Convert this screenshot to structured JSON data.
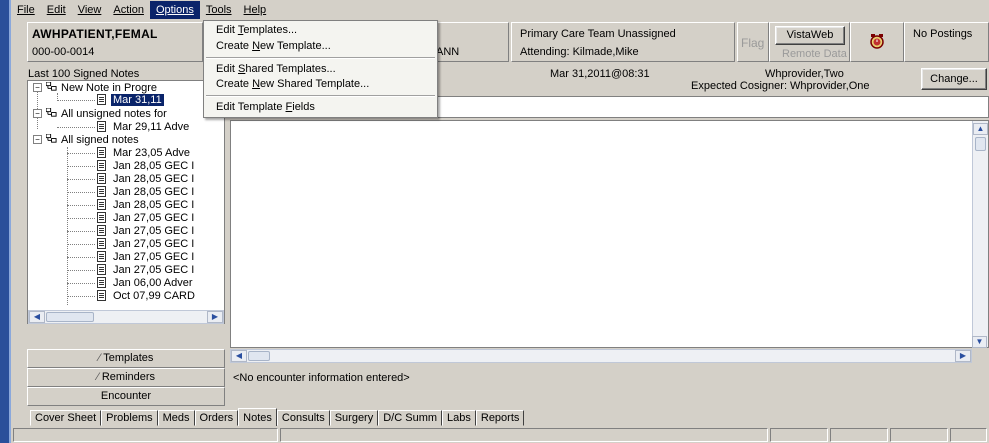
{
  "menubar": {
    "items": [
      "File",
      "Edit",
      "View",
      "Action",
      "Options",
      "Tools",
      "Help"
    ],
    "active_index": 4
  },
  "options_menu": {
    "items": [
      "Edit Templates...",
      "Create New Template...",
      "Edit Shared Templates...",
      "Create New Shared Template...",
      "Edit Template Fields"
    ]
  },
  "patient": {
    "name": "AWHPATIENT,FEMAL",
    "ssn": "000-00-0014",
    "location_fragment": "ANN"
  },
  "care_team": {
    "line1": "Primary Care Team Unassigned",
    "line2": "Attending:  Kilmade,Mike"
  },
  "flag_label": "Flag",
  "vistaweb": {
    "label": "VistaWeb",
    "sub": "Remote Data"
  },
  "postings_label": "No Postings",
  "notes_list_title": "Last 100 Signed Notes",
  "note_header": {
    "date": "Mar 31,2011@08:31",
    "author": "Whprovider,Two",
    "cosigner": "Expected Cosigner: Whprovider,One"
  },
  "change_button": "Change...",
  "tree": {
    "groups": [
      {
        "label": "New Note in Progre",
        "notes": [
          "Mar 31,11"
        ]
      },
      {
        "label": "All unsigned notes for",
        "notes": [
          "Mar 29,11  Adve"
        ]
      },
      {
        "label": "All signed notes",
        "notes": [
          "Mar 23,05  Adve",
          "Jan 28,05  GEC I",
          "Jan 28,05  GEC I",
          "Jan 28,05  GEC I",
          "Jan 28,05  GEC I",
          "Jan 27,05  GEC I",
          "Jan 27,05  GEC I",
          "Jan 27,05  GEC I",
          "Jan 27,05  GEC I",
          "Jan 27,05  GEC I",
          "Jan 06,00  Adver",
          "Oct 07,99  CARD"
        ]
      }
    ]
  },
  "panels": {
    "templates": "Templates",
    "reminders": "Reminders",
    "encounter": "Encounter"
  },
  "encounter_info": "<No encounter information entered>",
  "tabs": {
    "items": [
      "Cover Sheet",
      "Problems",
      "Meds",
      "Orders",
      "Notes",
      "Consults",
      "Surgery",
      "D/C Summ",
      "Labs",
      "Reports"
    ],
    "active_index": 4
  },
  "icons": {
    "remote_alert": "alarm-clock-icon",
    "folder": "folder-tree-icon",
    "note": "document-icon"
  },
  "colors": {
    "selection": "#0a246a",
    "window_bg": "#d4d0c8",
    "left_accent": "#2a4f9a"
  }
}
